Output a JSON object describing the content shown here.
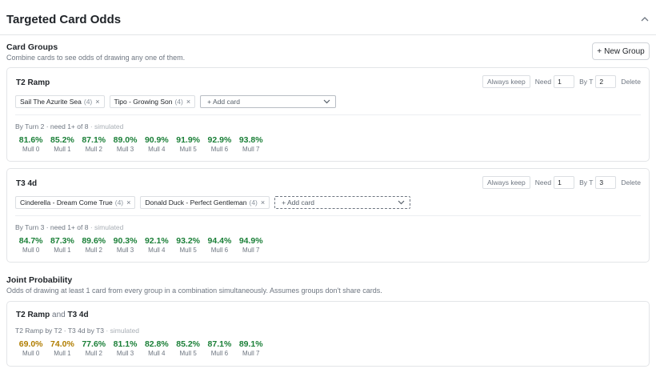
{
  "header": {
    "title": "Targeted Card Odds"
  },
  "card_groups": {
    "title": "Card Groups",
    "subtitle": "Combine cards to see odds of drawing any one of them.",
    "new_group_label": "New Group"
  },
  "controls": {
    "always_keep_label": "Always keep",
    "need_label": "Need",
    "by_label": "By T",
    "delete_label": "Delete",
    "add_card_placeholder": "+ Add card"
  },
  "groups": [
    {
      "name": "T2 Ramp",
      "need": "1",
      "by_turn": "2",
      "chips": [
        {
          "name": "Sail The Azurite Sea",
          "count": "(4)"
        },
        {
          "name": "Tipo - Growing Son",
          "count": "(4)"
        }
      ],
      "summary": "By Turn 2 · need 1+ of 8",
      "sim_tag": "· simulated",
      "odds": [
        {
          "pct": "81.6%",
          "label": "Mull 0"
        },
        {
          "pct": "85.2%",
          "label": "Mull 1"
        },
        {
          "pct": "87.1%",
          "label": "Mull 2"
        },
        {
          "pct": "89.0%",
          "label": "Mull 3"
        },
        {
          "pct": "90.9%",
          "label": "Mull 4"
        },
        {
          "pct": "91.9%",
          "label": "Mull 5"
        },
        {
          "pct": "92.9%",
          "label": "Mull 6"
        },
        {
          "pct": "93.8%",
          "label": "Mull 7"
        }
      ]
    },
    {
      "name": "T3 4d",
      "need": "1",
      "by_turn": "3",
      "chips": [
        {
          "name": "Cinderella - Dream Come True",
          "count": "(4)"
        },
        {
          "name": "Donald Duck - Perfect Gentleman",
          "count": "(4)"
        }
      ],
      "summary": "By Turn 3 · need 1+ of 8",
      "sim_tag": "· simulated",
      "odds": [
        {
          "pct": "84.7%",
          "label": "Mull 0"
        },
        {
          "pct": "87.3%",
          "label": "Mull 1"
        },
        {
          "pct": "89.6%",
          "label": "Mull 2"
        },
        {
          "pct": "90.3%",
          "label": "Mull 3"
        },
        {
          "pct": "92.1%",
          "label": "Mull 4"
        },
        {
          "pct": "93.2%",
          "label": "Mull 5"
        },
        {
          "pct": "94.4%",
          "label": "Mull 6"
        },
        {
          "pct": "94.9%",
          "label": "Mull 7"
        }
      ]
    }
  ],
  "joint": {
    "title": "Joint Probability",
    "subtitle": "Odds of drawing at least 1 card from every group in a combination simultaneously. Assumes groups don't share cards.",
    "combo": {
      "first": "T2 Ramp",
      "and": "and",
      "second": "T3 4d",
      "summary": "T2 Ramp by T2 · T3 4d by T3",
      "sim_tag": "· simulated",
      "odds": [
        {
          "pct": "69.0%",
          "label": "Mull 0",
          "warn": true
        },
        {
          "pct": "74.0%",
          "label": "Mull 1",
          "warn": true
        },
        {
          "pct": "77.6%",
          "label": "Mull 2"
        },
        {
          "pct": "81.1%",
          "label": "Mull 3"
        },
        {
          "pct": "82.8%",
          "label": "Mull 4"
        },
        {
          "pct": "85.2%",
          "label": "Mull 5"
        },
        {
          "pct": "87.1%",
          "label": "Mull 6"
        },
        {
          "pct": "89.1%",
          "label": "Mull 7"
        }
      ]
    }
  },
  "icons": {
    "collapse": "chevron-up-icon",
    "remove_chip": "close-icon",
    "dropdown": "chevron-down-icon",
    "add": "plus-icon"
  },
  "colors": {
    "success": "#1a7f37",
    "warning": "#b07d00"
  }
}
